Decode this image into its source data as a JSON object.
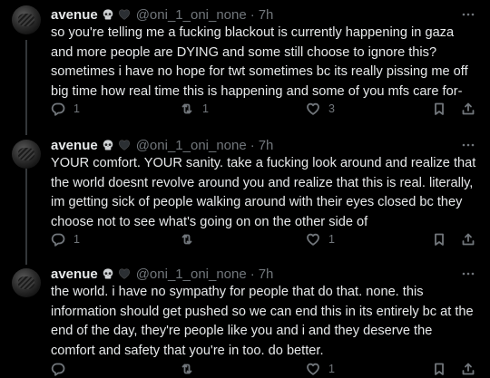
{
  "tweets": [
    {
      "name": "avenue",
      "handle": "@oni_1_oni_none",
      "dot": "·",
      "time": "7h",
      "text": "so you're telling me a fucking blackout is currently happening in gaza and more people are DYING and some still choose to ignore this? sometimes i have no hope for twt sometimes bc its really pissing me off big time how real time this is happening and some of you mfs care for-",
      "replies": "1",
      "retweets": "1",
      "likes": "3"
    },
    {
      "name": "avenue",
      "handle": "@oni_1_oni_none",
      "dot": "·",
      "time": "7h",
      "text": "YOUR comfort. YOUR sanity. take a fucking look around and realize that the world doesnt revolve around you and realize that this is real. literally, im getting sick of people walking around with their eyes closed bc they choose not to see what's going on on the other side of",
      "replies": "1",
      "retweets": "",
      "likes": "1"
    },
    {
      "name": "avenue",
      "handle": "@oni_1_oni_none",
      "dot": "·",
      "time": "7h",
      "text": "the world. i have no sympathy for people that do that. none. this information should get pushed so we can end this in its entirely bc at the end of the day, they're people like you and i and they deserve the comfort and safety that you're in too. do better.",
      "replies": "",
      "retweets": "",
      "likes": "1"
    }
  ],
  "colors": {
    "background": "#000000",
    "text": "#e7e9ea",
    "muted": "#71767b"
  },
  "icons": [
    "skull-emoji",
    "black-heart-emoji",
    "more-icon",
    "reply-icon",
    "retweet-icon",
    "like-icon",
    "bookmark-icon",
    "share-icon"
  ]
}
